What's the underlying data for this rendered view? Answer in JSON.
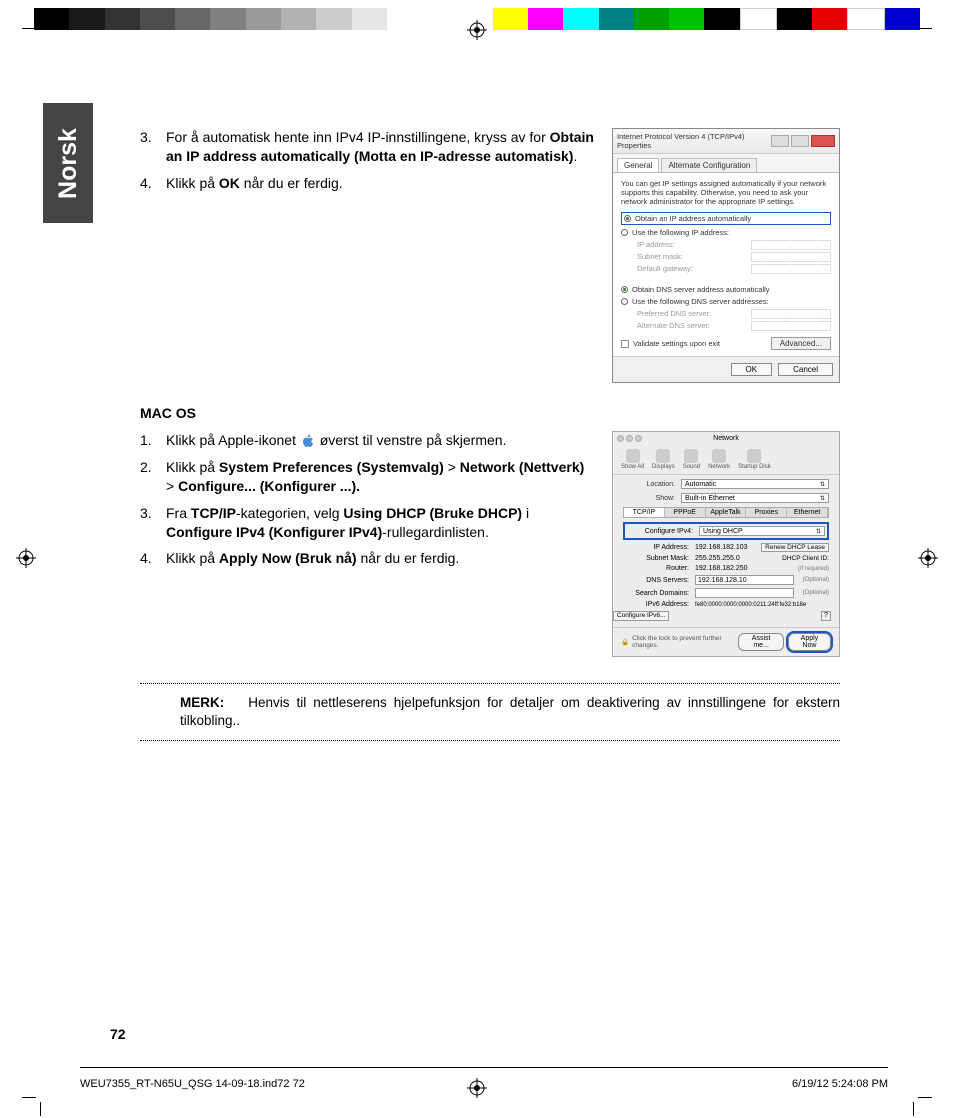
{
  "language_tab": "Norsk",
  "windows_steps": [
    {
      "num": "3.",
      "text_before": "For å automatisk hente inn IPv4 IP-innstillingene, kryss av for ",
      "bold": "Obtain an IP address automatically (Motta en IP-adresse automatisk)",
      "text_after": "."
    },
    {
      "num": "4.",
      "text_before": "Klikk på ",
      "bold": "OK",
      "text_after": " når du er ferdig."
    }
  ],
  "mac_heading": "MAC OS",
  "mac_steps": [
    {
      "num": "1.",
      "text_before": "Klikk på Apple-ikonet ",
      "has_icon": true,
      "text_after": " øverst til venstre på skjermen."
    },
    {
      "num": "2.",
      "text_before": "Klikk på ",
      "bold": "System Preferences (Systemvalg)",
      "mid1": " > ",
      "bold2": "Network (Nettverk)",
      "mid2": " > ",
      "bold3": "Configure... (Konfigurer ...).",
      "text_after": ""
    },
    {
      "num": "3.",
      "text_before": "Fra ",
      "bold": "TCP/IP",
      "mid1": "-kategorien, velg ",
      "bold2": "Using DHCP (Bruke DHCP)",
      "mid2": " i ",
      "bold3": "Configure IPv4 (Konfigurer IPv4)",
      "text_after": "-rullegardinlisten."
    },
    {
      "num": "4.",
      "text_before": "Klikk på ",
      "bold": "Apply Now (Bruk nå)",
      "text_after": " når du er ferdig."
    }
  ],
  "note": {
    "label": "MERK:",
    "text": "Henvis til nettleserens hjelpefunksjon for detaljer om deaktivering av innstillingene for ekstern tilkobling.."
  },
  "win_dialog": {
    "title": "Internet Protocol Version 4 (TCP/IPv4) Properties",
    "tabs": [
      "General",
      "Alternate Configuration"
    ],
    "desc": "You can get IP settings assigned automatically if your network supports this capability. Otherwise, you need to ask your network administrator for the appropriate IP settings.",
    "radio1": "Obtain an IP address automatically",
    "radio2": "Use the following IP address:",
    "ip_label": "IP address:",
    "mask_label": "Subnet mask:",
    "gw_label": "Default gateway:",
    "radio3": "Obtain DNS server address automatically",
    "radio4": "Use the following DNS server addresses:",
    "dns1_label": "Preferred DNS server:",
    "dns2_label": "Alternate DNS server:",
    "validate": "Validate settings upon exit",
    "advanced": "Advanced...",
    "ok": "OK",
    "cancel": "Cancel"
  },
  "mac_dialog": {
    "title": "Network",
    "icons": [
      "Show All",
      "Displays",
      "Sound",
      "Network",
      "Startup Disk"
    ],
    "location_lbl": "Location:",
    "location_val": "Automatic",
    "show_lbl": "Show:",
    "show_val": "Built-in Ethernet",
    "tabs": [
      "TCP/IP",
      "PPPoE",
      "AppleTalk",
      "Proxies",
      "Ethernet"
    ],
    "conf_lbl": "Configure IPv4:",
    "conf_val": "Using DHCP",
    "ip_lbl": "IP Address:",
    "ip_val": "192.168.182.103",
    "renew": "Renew DHCP Lease",
    "mask_lbl": "Subnet Mask:",
    "mask_val": "255.255.255.0",
    "client_lbl": "DHCP Client ID:",
    "router_lbl": "Router:",
    "router_val": "192.168.182.250",
    "ifreq": "(If required)",
    "dns_lbl": "DNS Servers:",
    "dns_val": "192.168.128.10",
    "search_lbl": "Search Domains:",
    "ipv6_lbl": "IPv6 Address:",
    "ipv6_val": "fe80:0000:0000:0000:0211:24ff:fe32:b18e",
    "conf_ipv6": "Configure IPv6...",
    "optional": "(Optional)",
    "lock_text": "Click the lock to prevent further changes.",
    "assist": "Assist me...",
    "apply": "Apply Now"
  },
  "page_number": "72",
  "footer_left": "WEU7355_RT-N65U_QSG 14-09-18.ind72   72",
  "footer_right": "6/19/12   5:24:08 PM"
}
